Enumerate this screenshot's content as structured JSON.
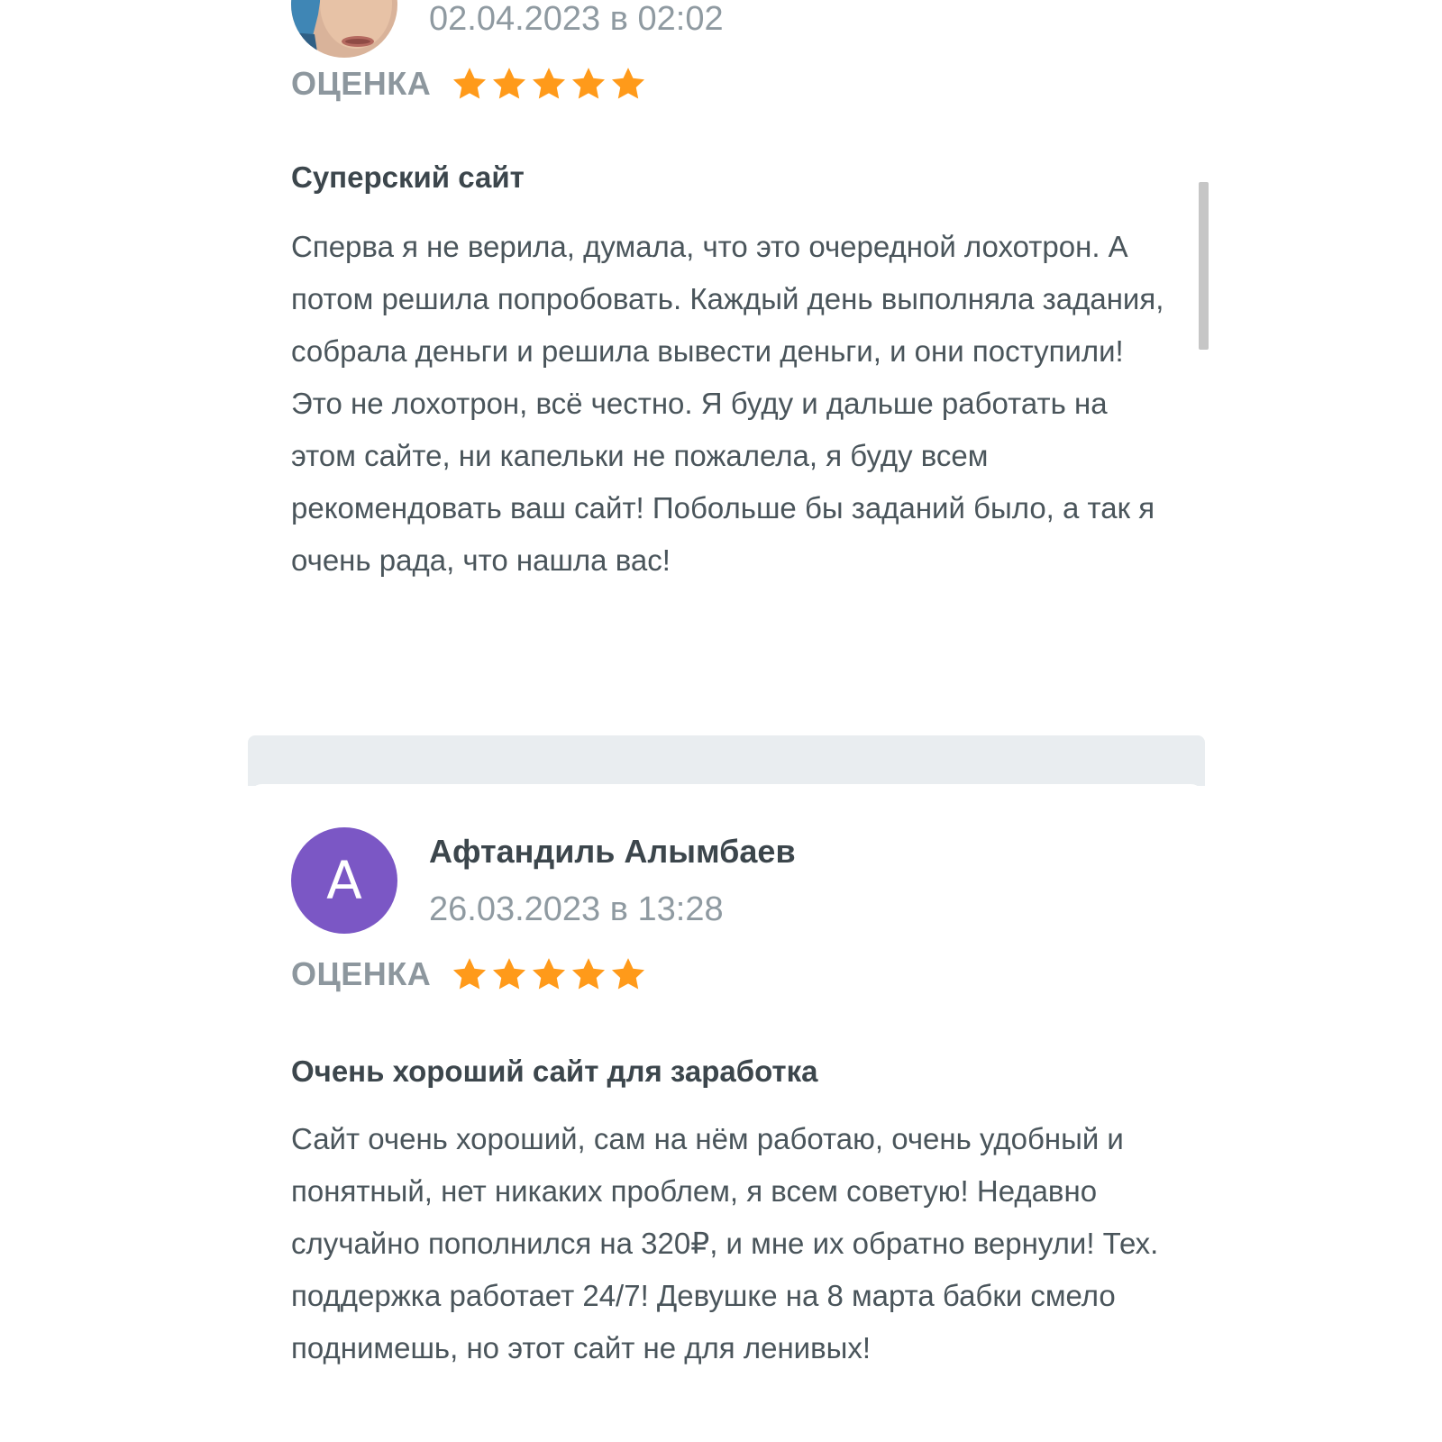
{
  "reviews": [
    {
      "author": "",
      "date": "02.04.2023 в 02:02",
      "rating_label": "ОЦЕНКА",
      "rating": 5,
      "title": "Суперский сайт",
      "text": "Сперва я не верила, думала, что это очередной лохотрон. А потом решила попробовать. Каждый день выполняла задания, собрала деньги и решила вывести деньги, и они поступили! Это не лохотрон, всё честно. Я буду и дальше работать на этом сайте, ни капельки не пожалела, я буду всем рекомендовать ваш сайт! Побольше бы заданий было, а так я очень рада, что нашла вас!"
    },
    {
      "author": "Афтандиль Алымбаев",
      "avatar_letter": "А",
      "avatar_color": "#7b57c5",
      "date": "26.03.2023 в 13:28",
      "rating_label": "ОЦЕНКА",
      "rating": 5,
      "title": "Очень хороший сайт для заработка",
      "text": "Сайт очень хороший, сам на нём работаю, очень удобный и понятный, нет никаких проблем, я всем советую! Недавно случайно пополнился на 320₽, и мне их обратно вернули! Тех. поддержка работает 24/7! Девушке на 8 марта бабки смело поднимешь, но этот сайт не для ленивых!"
    }
  ],
  "colors": {
    "star": "#ff9a1a",
    "separator": "#e9edf0",
    "avatar_purple": "#7b57c5"
  }
}
